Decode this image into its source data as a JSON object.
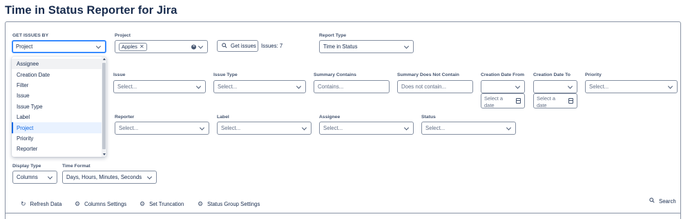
{
  "app": {
    "title": "Time in Status Reporter for Jira"
  },
  "get_issues_by": {
    "label": "GET ISSUES BY",
    "value": "Project",
    "options": [
      "Assignee",
      "Creation Date",
      "Filter",
      "Issue",
      "Issue Type",
      "Label",
      "Project",
      "Priority",
      "Reporter"
    ],
    "selected": "Project",
    "hovered": "Assignee"
  },
  "project": {
    "label": "Project",
    "tag": "Apples"
  },
  "get_issues_button": {
    "label": "Get issues"
  },
  "issues_count": "Issues: 7",
  "report_type": {
    "label": "Report Type",
    "value": "Time in Status"
  },
  "filters_row1": {
    "issue": {
      "label": "Issue",
      "placeholder": "Select..."
    },
    "issue_type": {
      "label": "Issue Type",
      "placeholder": "Select..."
    },
    "summary_contains": {
      "label": "Summary Contains",
      "placeholder": "Contains..."
    },
    "summary_not_contain": {
      "label": "Summary Does Not Contain",
      "placeholder": "Does not contain..."
    },
    "creation_date_from": {
      "label": "Creation Date From",
      "placeholder_line1": "Select a",
      "placeholder_line2": "date"
    },
    "creation_date_to": {
      "label": "Creation Date To",
      "placeholder_line1": "Select a",
      "placeholder_line2": "date"
    },
    "priority": {
      "label": "Priority",
      "placeholder": "Select..."
    }
  },
  "filters_row2": {
    "reporter": {
      "label": "Reporter",
      "placeholder": "Select..."
    },
    "label": {
      "label": "Label",
      "placeholder": "Select..."
    },
    "assignee": {
      "label": "Assignee",
      "placeholder": "Select..."
    },
    "status": {
      "label": "Status",
      "placeholder": "Select..."
    }
  },
  "display_type": {
    "label": "Display Type",
    "value": "Columns"
  },
  "time_format": {
    "label": "Time Format",
    "value": "Days, Hours, Minutes, Seconds"
  },
  "toolbar": {
    "refresh": "Refresh Data",
    "columns_settings": "Columns Settings",
    "set_truncation": "Set Truncation",
    "status_group_settings": "Status Group Settings",
    "search": "Search"
  },
  "colors": {
    "accent": "#0c66e4",
    "focus_border": "#388bff",
    "border": "#8590a2",
    "text": "#172b4d"
  }
}
